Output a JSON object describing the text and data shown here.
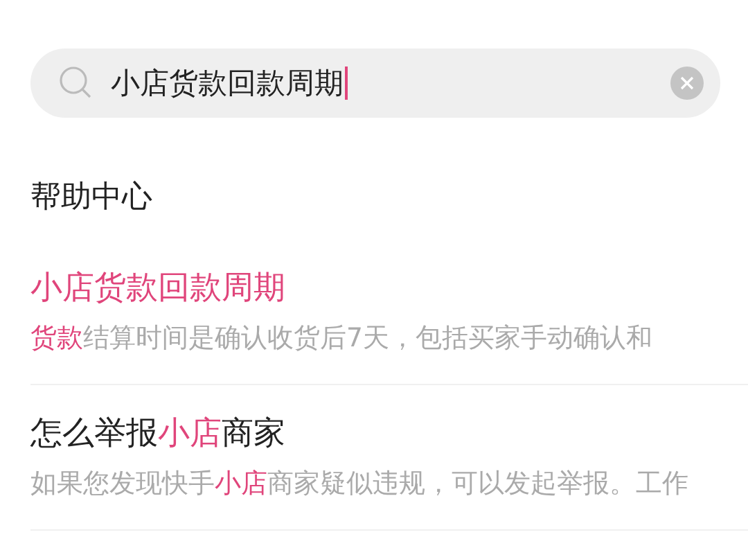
{
  "search": {
    "value": "小店货款回款周期",
    "focused": true
  },
  "section_title": "帮助中心",
  "results": [
    {
      "title": [
        {
          "text": "小店货款回款周期",
          "highlight": true
        }
      ],
      "snippet": [
        {
          "text": "货款",
          "highlight": true
        },
        {
          "text": "结算时间是确认收货后7天，包括买家手动确认和",
          "highlight": false
        }
      ]
    },
    {
      "title": [
        {
          "text": "怎么举报",
          "highlight": false
        },
        {
          "text": "小店",
          "highlight": true
        },
        {
          "text": "商家",
          "highlight": false
        }
      ],
      "snippet": [
        {
          "text": "如果您发现快手",
          "highlight": false
        },
        {
          "text": "小店",
          "highlight": true
        },
        {
          "text": "商家疑似违规，可以发起举报。工作",
          "highlight": false
        }
      ]
    }
  ]
}
